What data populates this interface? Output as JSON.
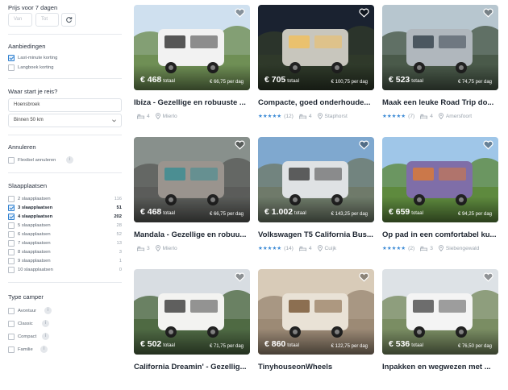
{
  "sidebar": {
    "price_title": "Prijs voor 7 dagen",
    "price_min_placeholder": "Van",
    "price_max_placeholder": "Tot",
    "offers_title": "Aanbiedingen",
    "offers": [
      {
        "label": "Last-minute korting",
        "checked": true
      },
      {
        "label": "Langboek korting",
        "checked": false
      }
    ],
    "location_title": "Waar start je reis?",
    "location_value": "Hoensbroek",
    "radius_value": "Binnen 50 km",
    "cancel_title": "Annuleren",
    "cancel_option": "Flexibel annuleren",
    "berths_title": "Slaapplaatsen",
    "berths": [
      {
        "label": "2 slaapplaatsen",
        "count": "116",
        "checked": false
      },
      {
        "label": "3 slaapplaatsen",
        "count": "51",
        "checked": true
      },
      {
        "label": "4 slaapplaatsen",
        "count": "202",
        "checked": true
      },
      {
        "label": "5 slaapplaatsen",
        "count": "28",
        "checked": false
      },
      {
        "label": "6 slaapplaatsen",
        "count": "52",
        "checked": false
      },
      {
        "label": "7 slaapplaatsen",
        "count": "13",
        "checked": false
      },
      {
        "label": "8 slaapplaatsen",
        "count": "3",
        "checked": false
      },
      {
        "label": "9 slaapplaatsen",
        "count": "1",
        "checked": false
      },
      {
        "label": "10 slaapplaatsen",
        "count": "0",
        "checked": false
      }
    ],
    "camper_title": "Type camper",
    "camper_types": [
      {
        "label": "Avontuur"
      },
      {
        "label": "Classic"
      },
      {
        "label": "Compact"
      },
      {
        "label": "Familie"
      }
    ]
  },
  "listings": [
    {
      "title": "Ibiza - Gezellige en robuuste ...",
      "price": "€ 468",
      "total": "totaal",
      "per_day": "€ 66,75 per dag",
      "rating": "",
      "reviews": "",
      "sleeps": "4",
      "city": "Mierlo"
    },
    {
      "title": "Compacte, goed onderhoude...",
      "price": "€ 705",
      "total": "totaal",
      "per_day": "€ 100,75 per dag",
      "rating": "★★★★★",
      "reviews": "(12)",
      "sleeps": "4",
      "city": "Staphorst"
    },
    {
      "title": "Maak een leuke Road Trip do...",
      "price": "€ 523",
      "total": "totaal",
      "per_day": "€ 74,75 per dag",
      "rating": "★★★★★",
      "reviews": "(7)",
      "sleeps": "4",
      "city": "Amersfoort"
    },
    {
      "title": "Mandala - Gezellige en robuu...",
      "price": "€ 468",
      "total": "totaal",
      "per_day": "€ 66,75 per dag",
      "rating": "",
      "reviews": "",
      "sleeps": "3",
      "city": "Mierlo"
    },
    {
      "title": "Volkswagen T5 California Bus...",
      "price": "€ 1.002",
      "total": "totaal",
      "per_day": "€ 143,25 per dag",
      "rating": "★★★★★",
      "reviews": "(14)",
      "sleeps": "4",
      "city": "Cuijk"
    },
    {
      "title": "Op pad in een comfortabel ku...",
      "price": "€ 659",
      "total": "totaal",
      "per_day": "€ 94,25 per dag",
      "rating": "★★★★★",
      "reviews": "(2)",
      "sleeps": "3",
      "city": "Siebengewald"
    },
    {
      "title": "California Dreamin' - Gezellig...",
      "price": "€ 502",
      "total": "totaal",
      "per_day": "€ 71,75 per dag",
      "rating": "",
      "reviews": "",
      "sleeps": "",
      "city": ""
    },
    {
      "title": "TinyhouseonWheels",
      "price": "€ 860",
      "total": "totaal",
      "per_day": "€ 122,75 per dag",
      "rating": "",
      "reviews": "",
      "sleeps": "",
      "city": ""
    },
    {
      "title": "Inpakken en wegwezen met ...",
      "price": "€ 536",
      "total": "totaal",
      "per_day": "€ 76,50 per dag",
      "rating": "",
      "reviews": "",
      "sleeps": "",
      "city": ""
    }
  ],
  "colors": {
    "accent": "#2d7fd0",
    "stars": "#3d8bd6",
    "muted": "#9aa3ad"
  }
}
